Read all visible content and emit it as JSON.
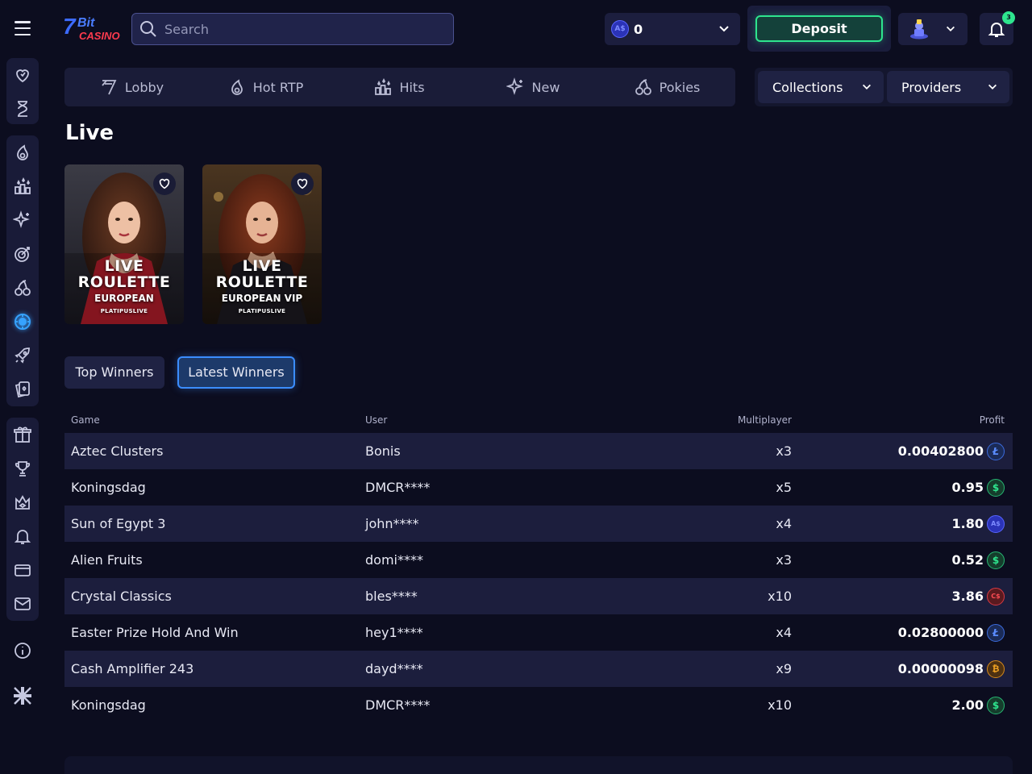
{
  "header": {
    "logo_text": "7BitCasino",
    "search_placeholder": "Search",
    "balance_currency": "A$",
    "balance_amount": "0",
    "deposit_label": "Deposit",
    "notification_count": "3"
  },
  "nav": {
    "items": [
      {
        "label": "Lobby",
        "icon": "lobby-icon"
      },
      {
        "label": "Hot RTP",
        "icon": "flame-icon"
      },
      {
        "label": "Hits",
        "icon": "hits-icon"
      },
      {
        "label": "New",
        "icon": "sparkle-icon"
      },
      {
        "label": "Pokies",
        "icon": "cherry-icon"
      }
    ],
    "collections_label": "Collections",
    "providers_label": "Providers"
  },
  "section": {
    "title": "Live"
  },
  "games": [
    {
      "title_line1": "LIVE",
      "title_line2": "ROULETTE",
      "subtitle": "EUROPEAN",
      "provider": "PLATIPUSLIVE"
    },
    {
      "title_line1": "LIVE",
      "title_line2": "ROULETTE",
      "subtitle": "EUROPEAN VIP",
      "provider": "PLATIPUSLIVE"
    }
  ],
  "tabs": {
    "top_winners": "Top Winners",
    "latest_winners": "Latest Winners"
  },
  "table": {
    "headers": {
      "game": "Game",
      "user": "User",
      "multiplier": "Multiplayer",
      "profit": "Profit"
    },
    "rows": [
      {
        "game": "Aztec Clusters",
        "user": "Bonis",
        "multiplier": "x3",
        "profit": "0.00402800",
        "currency": "LTC",
        "currency_glyph": "Ł"
      },
      {
        "game": "Koningsdag",
        "user": "DMCR****",
        "multiplier": "x5",
        "profit": "0.95",
        "currency": "USD",
        "currency_glyph": "$"
      },
      {
        "game": "Sun of Egypt 3",
        "user": "john****",
        "multiplier": "x4",
        "profit": "1.80",
        "currency": "AUD",
        "currency_glyph": "A$"
      },
      {
        "game": "Alien Fruits",
        "user": "domi****",
        "multiplier": "x3",
        "profit": "0.52",
        "currency": "USD",
        "currency_glyph": "$"
      },
      {
        "game": "Crystal Classics",
        "user": "bles****",
        "multiplier": "x10",
        "profit": "3.86",
        "currency": "CAD",
        "currency_glyph": "C$"
      },
      {
        "game": "Easter Prize Hold And Win",
        "user": "hey1****",
        "multiplier": "x4",
        "profit": "0.02800000",
        "currency": "LTC",
        "currency_glyph": "Ł"
      },
      {
        "game": "Cash Amplifier 243",
        "user": "dayd****",
        "multiplier": "x9",
        "profit": "0.00000098",
        "currency": "BTC",
        "currency_glyph": "₿"
      },
      {
        "game": "Koningsdag",
        "user": "DMCR****",
        "multiplier": "x10",
        "profit": "2.00",
        "currency": "USD",
        "currency_glyph": "$"
      }
    ]
  },
  "colors": {
    "background": "#0c0d1f",
    "panel": "#1a1c38",
    "deposit_green": "#2ee58e",
    "active_blue": "#3b8dff"
  }
}
